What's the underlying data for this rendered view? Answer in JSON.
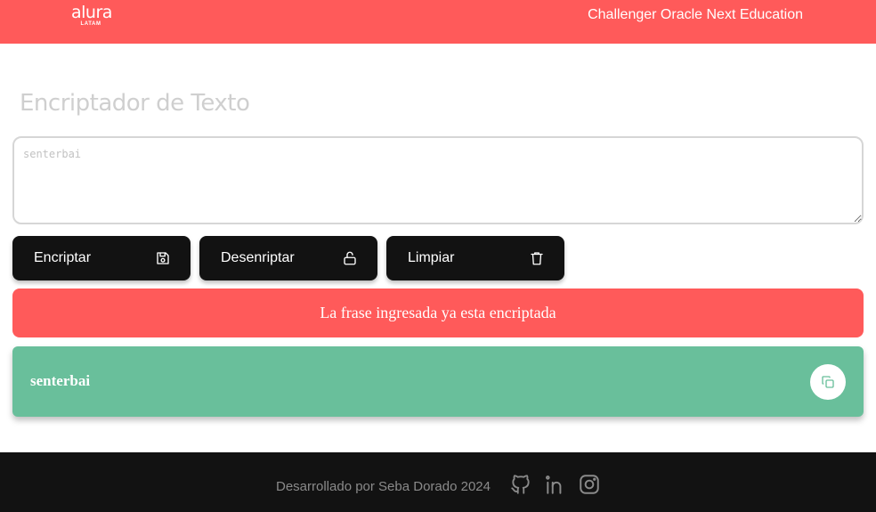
{
  "header": {
    "logo_main": "alura",
    "logo_sub": "LATAM",
    "title": "Challenger Oracle Next Education"
  },
  "main": {
    "title": "Encriptador de Texto",
    "input": {
      "placeholder": "senterbai",
      "value": ""
    },
    "buttons": [
      {
        "label": "Encriptar",
        "icon": "save-icon"
      },
      {
        "label": "Desenriptar",
        "icon": "unlock-icon"
      },
      {
        "label": "Limpiar",
        "icon": "trash-icon"
      }
    ],
    "alert": "La frase ingresada ya esta encriptada",
    "result": {
      "text": "senterbai",
      "copy_icon": "copy-icon"
    }
  },
  "footer": {
    "text": "Desarrollado por Seba Dorado 2024",
    "icons": [
      "github-icon",
      "linkedin-icon",
      "instagram-icon"
    ]
  },
  "colors": {
    "header_bg": "#ff5a5a",
    "alert_bg": "#ff5a5a",
    "result_bg": "#69bf9b",
    "button_bg": "#121212",
    "footer_bg": "#121212"
  }
}
